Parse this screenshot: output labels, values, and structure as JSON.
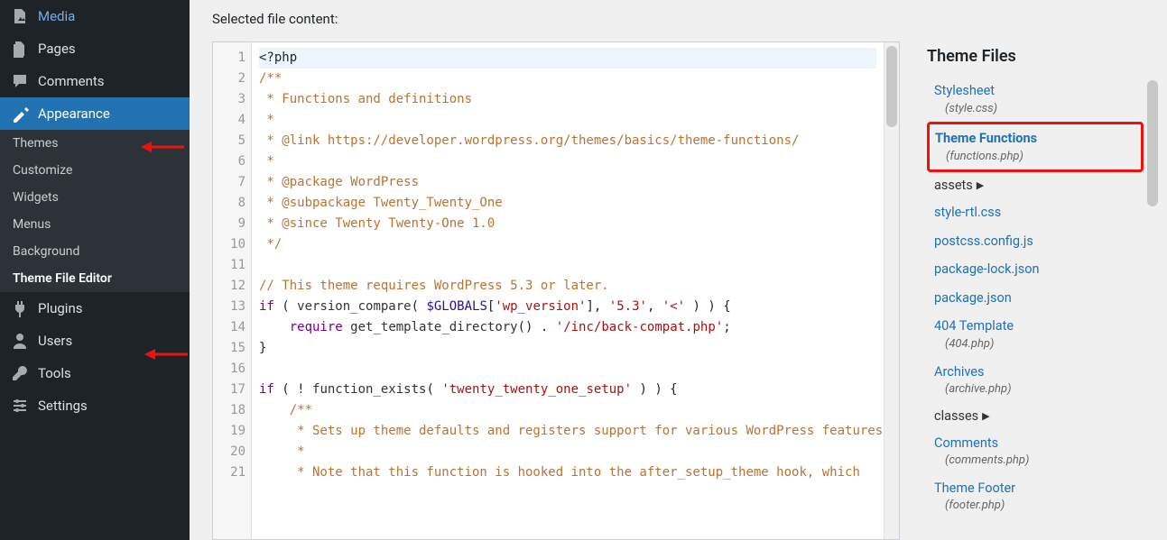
{
  "sidebar": {
    "top": [
      {
        "icon": "media",
        "label": "Media"
      },
      {
        "icon": "pages",
        "label": "Pages"
      },
      {
        "icon": "comments",
        "label": "Comments"
      },
      {
        "icon": "appearance",
        "label": "Appearance",
        "current": true
      }
    ],
    "appearance_sub": [
      {
        "label": "Themes"
      },
      {
        "label": "Customize"
      },
      {
        "label": "Widgets"
      },
      {
        "label": "Menus"
      },
      {
        "label": "Background"
      },
      {
        "label": "Theme File Editor",
        "current": true
      }
    ],
    "bottom": [
      {
        "icon": "plugins",
        "label": "Plugins"
      },
      {
        "icon": "users",
        "label": "Users"
      },
      {
        "icon": "tools",
        "label": "Tools"
      },
      {
        "icon": "settings",
        "label": "Settings"
      }
    ]
  },
  "main": {
    "heading": "Selected file content:",
    "lines": [
      "<?php",
      "/**",
      " * Functions and definitions",
      " *",
      " * @link https://developer.wordpress.org/themes/basics/theme-functions/",
      " *",
      " * @package WordPress",
      " * @subpackage Twenty_Twenty_One",
      " * @since Twenty Twenty-One 1.0",
      " */",
      "",
      "// This theme requires WordPress 5.3 or later.",
      "if ( version_compare( $GLOBALS['wp_version'], '5.3', '<' ) ) {",
      "    require get_template_directory() . '/inc/back-compat.php';",
      "}",
      "",
      "if ( ! function_exists( 'twenty_twenty_one_setup' ) ) {",
      "    /**",
      "     * Sets up theme defaults and registers support for various WordPress features.",
      "     *",
      "     * Note that this function is hooked into the after_setup_theme hook, which"
    ]
  },
  "right": {
    "title": "Theme Files",
    "entries": [
      {
        "type": "file",
        "name": "Stylesheet",
        "sub": "(style.css)"
      },
      {
        "type": "file",
        "name": "Theme Functions",
        "sub": "(functions.php)",
        "current": true
      },
      {
        "type": "folder",
        "name": "assets"
      },
      {
        "type": "file",
        "name": "style-rtl.css"
      },
      {
        "type": "file",
        "name": "postcss.config.js"
      },
      {
        "type": "file",
        "name": "package-lock.json"
      },
      {
        "type": "file",
        "name": "package.json"
      },
      {
        "type": "file",
        "name": "404 Template",
        "sub": "(404.php)"
      },
      {
        "type": "file",
        "name": "Archives",
        "sub": "(archive.php)"
      },
      {
        "type": "folder",
        "name": "classes"
      },
      {
        "type": "file",
        "name": "Comments",
        "sub": "(comments.php)"
      },
      {
        "type": "file",
        "name": "Theme Footer",
        "sub": "(footer.php)"
      }
    ]
  }
}
